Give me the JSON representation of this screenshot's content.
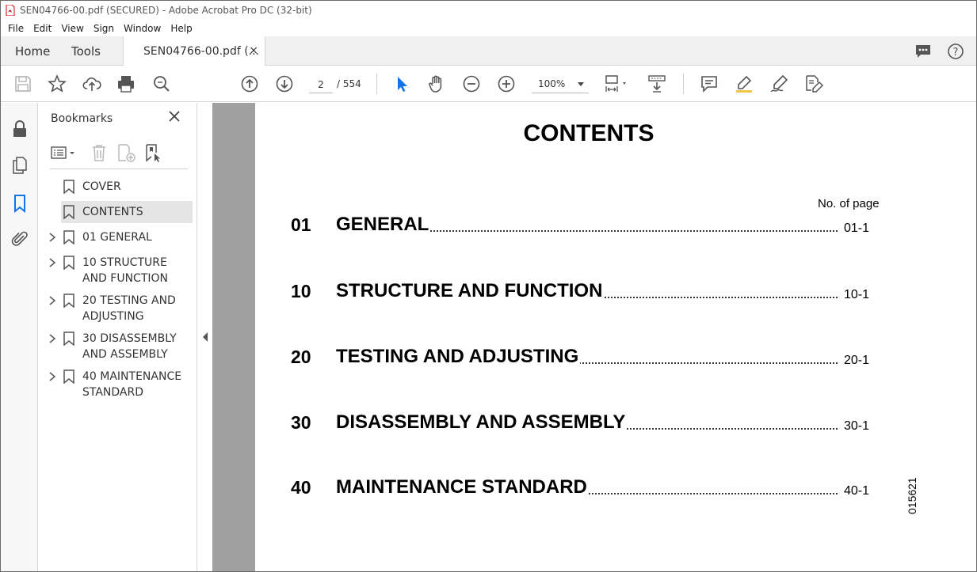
{
  "window": {
    "title": "SEN04766-00.pdf (SECURED) - Adobe Acrobat Pro DC (32-bit)"
  },
  "menu": [
    "File",
    "Edit",
    "View",
    "Sign",
    "Window",
    "Help"
  ],
  "tabs": {
    "home": "Home",
    "tools": "Tools",
    "document": "SEN04766-00.pdf (...",
    "close": "×"
  },
  "toolbar": {
    "page_current": "2",
    "page_total": "/ 554",
    "zoom": "100%"
  },
  "icons": {
    "left_rail": [
      "lock-icon",
      "pages-icon",
      "bookmark-icon",
      "attachment-icon"
    ],
    "toolbar": [
      "save-icon",
      "star-icon",
      "upload-icon",
      "print-icon",
      "zoom-search-icon",
      "page-up-icon",
      "page-down-icon",
      "select-arrow-icon",
      "hand-icon",
      "zoom-out-icon",
      "zoom-in-icon",
      "page-fit-icon",
      "scroll-mode-icon",
      "comment-icon",
      "highlight-icon",
      "sign-icon",
      "edit-icon"
    ]
  },
  "bookmarks": {
    "title": "Bookmarks",
    "items": [
      {
        "label": "COVER",
        "expandable": false,
        "selected": false
      },
      {
        "label": "CONTENTS",
        "expandable": false,
        "selected": true
      },
      {
        "label": "01 GENERAL",
        "expandable": true,
        "selected": false
      },
      {
        "label": "10 STRUCTURE AND FUNCTION",
        "expandable": true,
        "selected": false
      },
      {
        "label": "20 TESTING AND ADJUSTING",
        "expandable": true,
        "selected": false
      },
      {
        "label": "30 DISASSEMBLY AND ASSEMBLY",
        "expandable": true,
        "selected": false
      },
      {
        "label": "40 MAINTENANCE STANDARD",
        "expandable": true,
        "selected": false
      }
    ]
  },
  "document": {
    "title": "CONTENTS",
    "column_header": "No. of page",
    "entries": [
      {
        "num": "01",
        "title": "GENERAL",
        "page": "01-1"
      },
      {
        "num": "10",
        "title": "STRUCTURE AND FUNCTION",
        "page": "10-1"
      },
      {
        "num": "20",
        "title": "TESTING AND ADJUSTING",
        "page": "20-1"
      },
      {
        "num": "30",
        "title": "DISASSEMBLY AND ASSEMBLY",
        "page": "30-1"
      },
      {
        "num": "40",
        "title": "MAINTENANCE STANDARD",
        "page": "40-1"
      }
    ],
    "code": "015621"
  },
  "colors": {
    "accent": "#1473e6",
    "page_gutter": "#a0a0a0",
    "selected_bg": "#e5e5e5"
  }
}
